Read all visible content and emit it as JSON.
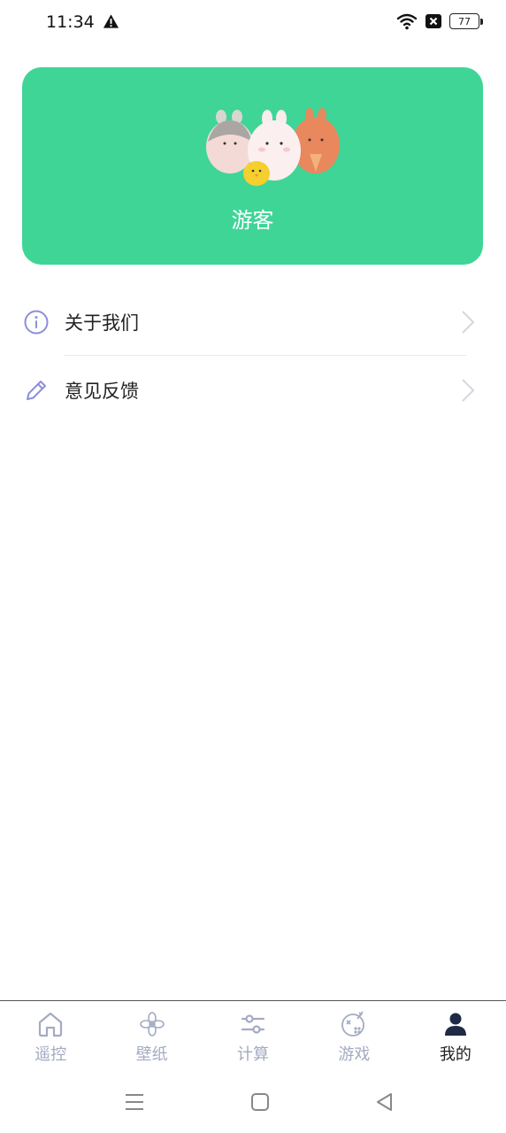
{
  "status_bar": {
    "time": "11:34",
    "battery": "77"
  },
  "profile": {
    "username": "游客",
    "card_color": "#3fd597"
  },
  "menu": [
    {
      "label": "关于我们",
      "icon": "info-icon"
    },
    {
      "label": "意见反馈",
      "icon": "edit-icon"
    }
  ],
  "tabs": [
    {
      "label": "遥控",
      "icon": "home-icon",
      "active": false
    },
    {
      "label": "壁纸",
      "icon": "flower-icon",
      "active": false
    },
    {
      "label": "计算",
      "icon": "sliders-icon",
      "active": false
    },
    {
      "label": "游戏",
      "icon": "gamepad-icon",
      "active": false
    },
    {
      "label": "我的",
      "icon": "user-icon",
      "active": true
    }
  ],
  "colors": {
    "accent": "#3fd597",
    "icon_purple": "#8c8fd8",
    "tab_inactive": "#a3abc2",
    "tab_active": "#222222"
  }
}
